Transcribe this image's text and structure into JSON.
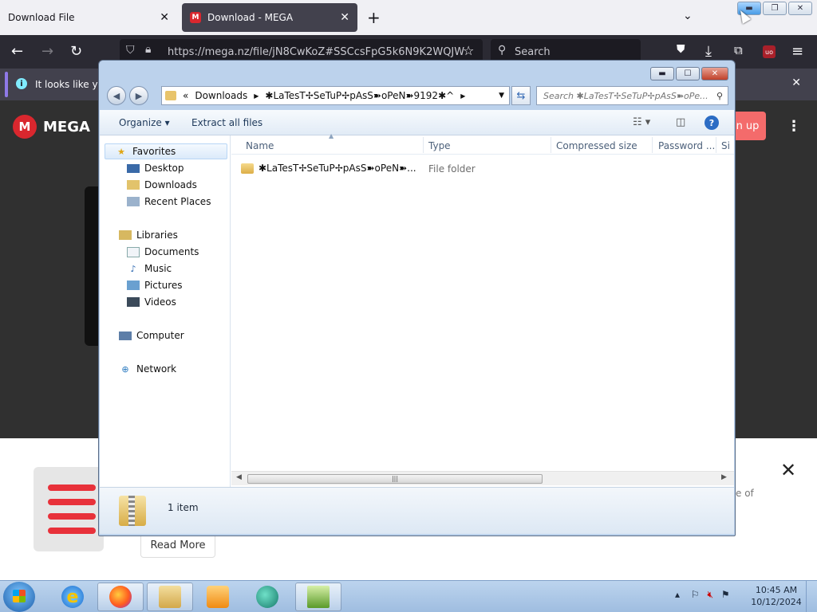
{
  "browser": {
    "tabs": [
      {
        "label": "Download File"
      },
      {
        "label": "Download - MEGA"
      }
    ],
    "url": "https://mega.nz/file/jN8CwKoZ#SSCcsFpG5k6N9K2WQJW",
    "search_placeholder": "Search",
    "notification": "It looks like you"
  },
  "mega": {
    "brand": "MEGA",
    "signup": "n up",
    "read_more": "Read More",
    "snippet": "e of"
  },
  "explorer": {
    "address_prefix": "«",
    "address_segments": [
      "Downloads",
      "✱LaTesT✢SeTuP✢pAsS➽oPeN➽9192✱^"
    ],
    "search_placeholder": "Search ✱LaTesT✢SeTuP✢pAsS➽oPe...",
    "toolbar": {
      "organize": "Organize",
      "extract": "Extract all files"
    },
    "nav": {
      "favorites": "Favorites",
      "favorites_items": [
        "Desktop",
        "Downloads",
        "Recent Places"
      ],
      "libraries": "Libraries",
      "libraries_items": [
        "Documents",
        "Music",
        "Pictures",
        "Videos"
      ],
      "computer": "Computer",
      "network": "Network"
    },
    "columns": [
      "Name",
      "Type",
      "Compressed size",
      "Password ...",
      "Si"
    ],
    "files": [
      {
        "name": "✱LaTesT✢SeTuP✢pAsS➽oPeN➽...",
        "type": "File folder"
      }
    ],
    "item_count": "1 item"
  },
  "taskbar": {
    "time": "10:45 AM",
    "date": "10/12/2024"
  }
}
